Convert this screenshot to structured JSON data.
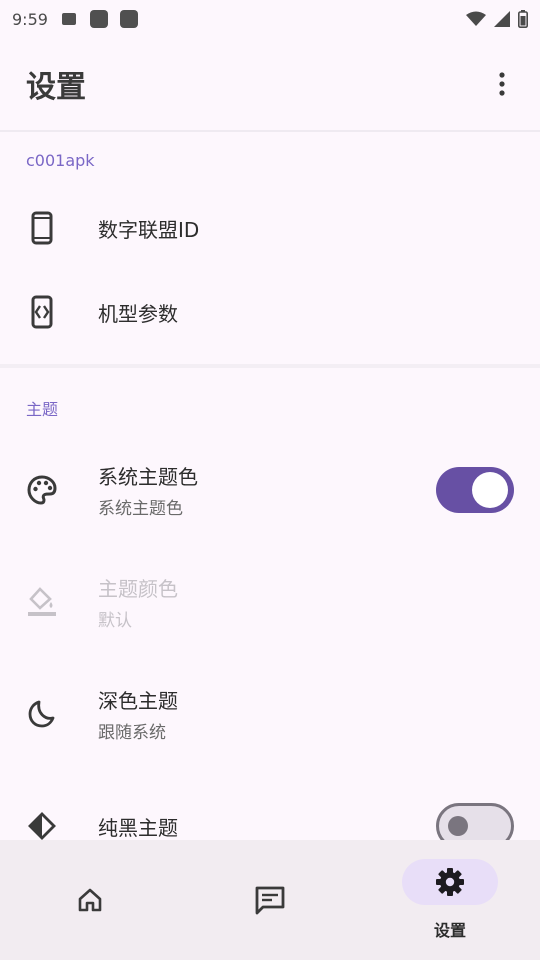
{
  "status_bar": {
    "time": "9:59",
    "icons": [
      "notification-icon",
      "app-notification-icon",
      "app-notification-icon",
      "wifi-icon",
      "cellular-signal-icon",
      "battery-icon"
    ]
  },
  "app_bar": {
    "title": "设置",
    "menu_icon": "more-vertical-icon"
  },
  "sections": [
    {
      "header": "c001apk",
      "items": [
        {
          "icon": "smartphone-icon",
          "title": "数字联盟ID"
        },
        {
          "icon": "device-parameters-icon",
          "title": "机型参数"
        }
      ]
    },
    {
      "header": "主题",
      "items": [
        {
          "icon": "palette-icon",
          "title": "系统主题色",
          "subtitle": "系统主题色",
          "toggle": true
        },
        {
          "icon": "format-color-fill-icon",
          "title": "主题颜色",
          "subtitle": "默认",
          "disabled": true
        },
        {
          "icon": "dark-mode-icon",
          "title": "深色主题",
          "subtitle": "跟随系统"
        },
        {
          "icon": "contrast-icon",
          "title": "纯黑主题",
          "toggle": false
        }
      ]
    }
  ],
  "bottom_nav": {
    "items": [
      {
        "icon": "home-icon",
        "label": "",
        "active": false
      },
      {
        "icon": "message-icon",
        "label": "",
        "active": false
      },
      {
        "icon": "settings-gear-icon",
        "label": "设置",
        "active": true
      }
    ]
  },
  "colors": {
    "accent": "#6750A4",
    "section_header": "#7A67C6",
    "background": "#FDF7FD",
    "nav_background": "#F2ECF1",
    "nav_active_pill": "#E8DEF8"
  }
}
